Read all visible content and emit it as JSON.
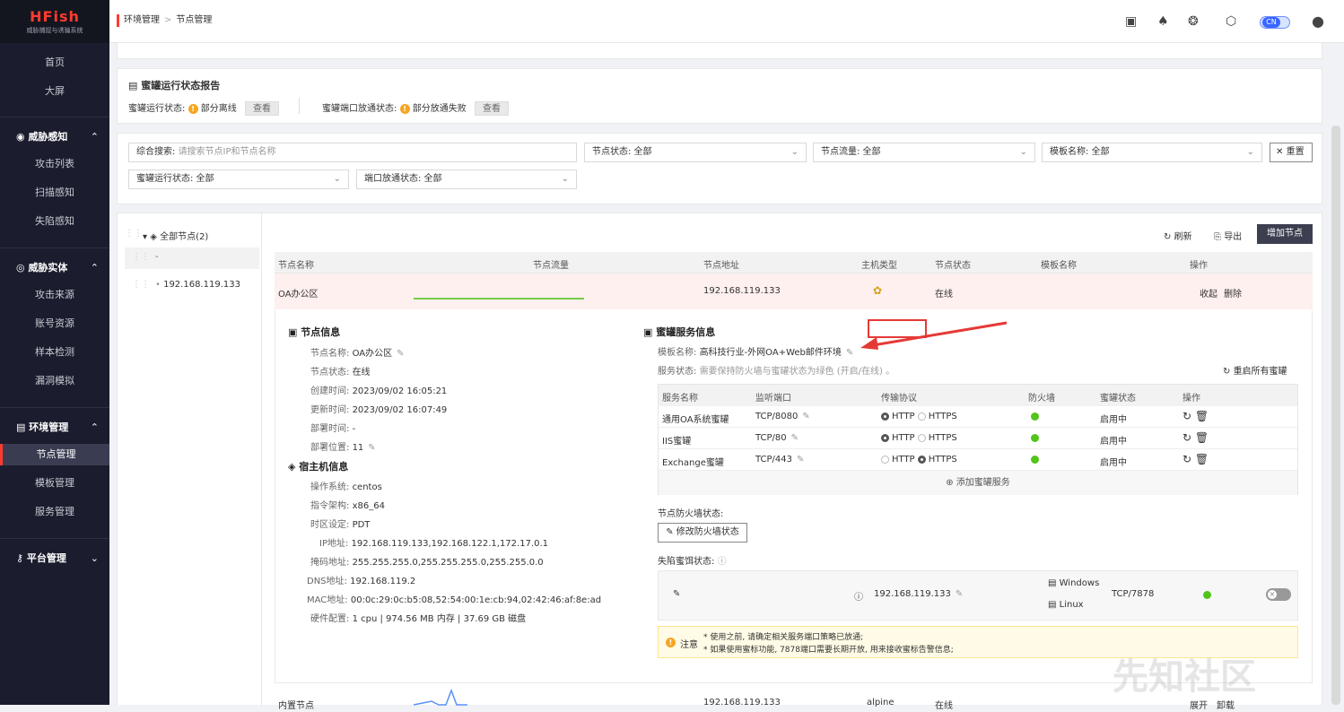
{
  "brand": {
    "name": "HFish",
    "subtitle": "威胁捕捉与诱骗系统"
  },
  "sidebar": {
    "home": "首页",
    "screen": "大屏",
    "threat_perception": {
      "label": "威胁感知",
      "items": [
        "攻击列表",
        "扫描感知",
        "失陷感知"
      ]
    },
    "threat_entity": {
      "label": "威胁实体",
      "items": [
        "攻击来源",
        "账号资源",
        "样本检测",
        "漏洞模拟"
      ]
    },
    "env_mgmt": {
      "label": "环境管理",
      "items": [
        "节点管理",
        "模板管理",
        "服务管理"
      ]
    },
    "platform": {
      "label": "平台管理"
    }
  },
  "breadcrumb": {
    "parent": "环境管理",
    "sep": ">",
    "current": "节点管理"
  },
  "top": {
    "lang": "CN"
  },
  "status_report": {
    "title": "蜜罐运行状态报告",
    "run_label": "蜜罐运行状态:",
    "run_value": "部分离线",
    "run_btn": "查看",
    "port_label": "蜜罐端口放通状态:",
    "port_value": "部分放通失败",
    "port_btn": "查看"
  },
  "filters": {
    "search_label": "综合搜索:",
    "search_placeholder": "请搜索节点IP和节点名称",
    "node_status": "节点状态: 全部",
    "node_traffic": "节点流量: 全部",
    "template": "模板名称: 全部",
    "reset": "重置",
    "honeypot_status": "蜜罐运行状态: 全部",
    "port_status": "端口放通状态: 全部"
  },
  "tree": {
    "root": "全部节点(2)",
    "item1": "-",
    "item2": "192.168.119.133"
  },
  "actions": {
    "refresh": "刷新",
    "export": "导出",
    "add": "增加节点"
  },
  "table": {
    "headers": [
      "节点名称",
      "节点流量",
      "节点地址",
      "主机类型",
      "节点状态",
      "模板名称",
      "操作"
    ],
    "row1": {
      "name": "OA办公区",
      "address": "192.168.119.133",
      "status": "在线",
      "collapse": "收起",
      "delete": "删除"
    },
    "row2": {
      "name": "内置节点",
      "address": "192.168.119.133",
      "host": "alpine",
      "status": "在线",
      "expand": "展开",
      "uninstall": "卸载"
    }
  },
  "node_info": {
    "title": "节点信息",
    "rows": [
      {
        "k": "节点名称:",
        "v": "OA办公区"
      },
      {
        "k": "节点状态:",
        "v": "在线"
      },
      {
        "k": "创建时间:",
        "v": "2023/09/02 16:05:21"
      },
      {
        "k": "更新时间:",
        "v": "2023/09/02 16:07:49"
      },
      {
        "k": "部署时间:",
        "v": "-"
      },
      {
        "k": "部署位置:",
        "v": "11"
      }
    ]
  },
  "host_info": {
    "title": "宿主机信息",
    "rows": [
      {
        "k": "操作系统:",
        "v": "centos"
      },
      {
        "k": "指令架构:",
        "v": "x86_64"
      },
      {
        "k": "时区设定:",
        "v": "PDT"
      },
      {
        "k": "IP地址:",
        "v": "192.168.119.133,192.168.122.1,172.17.0.1"
      },
      {
        "k": "掩码地址:",
        "v": "255.255.255.0,255.255.255.0,255.255.0.0"
      },
      {
        "k": "DNS地址:",
        "v": "192.168.119.2"
      },
      {
        "k": "MAC地址:",
        "v": "00:0c:29:0c:b5:08,52:54:00:1e:cb:94,02:42:46:af:8e:ad"
      },
      {
        "k": "硬件配置:",
        "v": "1 cpu | 974.56 MB 内存 | 37.69 GB 磁盘"
      }
    ]
  },
  "service_info": {
    "title": "蜜罐服务信息",
    "template_label": "模板名称:",
    "template_value": "高科技行业-外网OA+Web邮件环境",
    "status_label": "服务状态:",
    "status_hint": "需要保持防火墙与蜜罐状态为绿色 (开启/在线) 。",
    "restart_all": "重启所有蜜罐",
    "headers": [
      "服务名称",
      "监听端口",
      "传输协议",
      "防火墙",
      "蜜罐状态",
      "操作"
    ],
    "services": [
      {
        "name": "通用OA系统蜜罐",
        "port": "TCP/8080",
        "http": "HTTP",
        "https": "HTTPS",
        "state": "启用中"
      },
      {
        "name": "IIS蜜罐",
        "port": "TCP/80",
        "http": "HTTP",
        "https": "HTTPS",
        "state": "启用中"
      },
      {
        "name": "Exchange蜜罐",
        "port": "TCP/443",
        "http": "HTTP",
        "https": "HTTPS",
        "state": "启用中"
      }
    ],
    "add_service": "添加蜜罐服务",
    "firewall_label": "节点防火墙状态:",
    "firewall_btn": "修改防火墙状态",
    "trap_label": "失陷蜜饵状态:",
    "trap": {
      "ip": "192.168.119.133",
      "os1": "Windows",
      "os2": "Linux",
      "port": "TCP/7878"
    },
    "notice_label": "注意",
    "notice1": "* 使用之前, 请确定相关服务端口策略已放通;",
    "notice2": "* 如果使用蜜标功能, 7878端口需要长期开放, 用来接收蜜标告警信息;"
  },
  "watermark": "先知社区"
}
